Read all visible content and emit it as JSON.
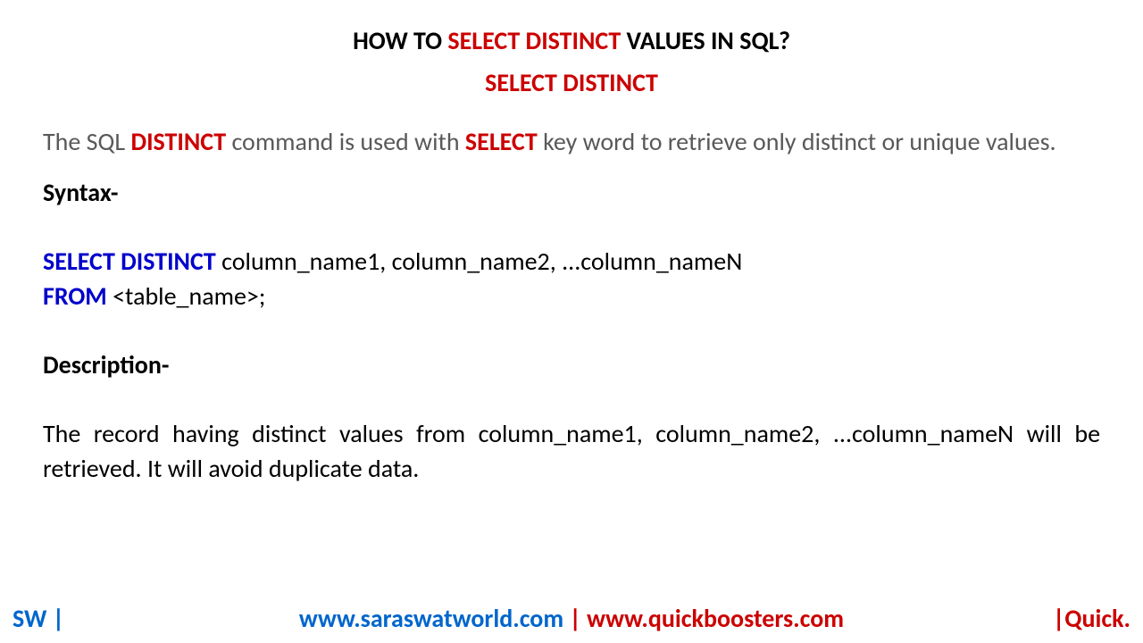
{
  "title": {
    "part1": "HOW TO ",
    "highlight": "SELECT DISTINCT",
    "part2": " VALUES IN SQL?"
  },
  "subtitle": "SELECT DISTINCT",
  "intro": {
    "part1": "The SQL ",
    "distinct": "DISTINCT",
    "part2": " command is used with ",
    "select": "SELECT",
    "part3": " key word to retrieve only distinct or unique values."
  },
  "syntax_label": "Syntax-",
  "syntax": {
    "line1_keyword": "SELECT DISTINCT",
    "line1_rest": " column_name1, column_name2, ...column_nameN",
    "line2_keyword": "FROM",
    "line2_rest": " <table_name>;"
  },
  "description_label": "Description-",
  "description_text": "The record having distinct values from column_name1, column_name2, ...column_nameN will be retrieved. It will avoid duplicate data.",
  "footer": {
    "left": "SW |",
    "url1": "www.saraswatworld.com",
    "separator": " | ",
    "url2": "www.quickboosters.com",
    "right": "|Quick."
  }
}
